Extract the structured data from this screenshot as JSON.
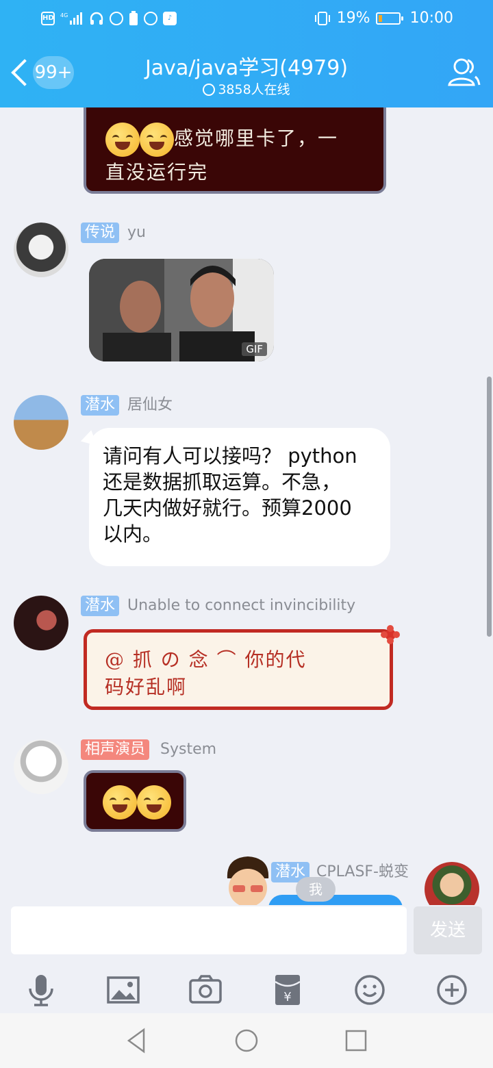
{
  "status_bar": {
    "icons_left": [
      "hd-icon",
      "4g-signal-icon",
      "headset-icon",
      "globe-icon",
      "battery-saver-icon",
      "video-icon",
      "tiktok-icon"
    ],
    "hd": "HD",
    "battery_pct": "19%",
    "time": "10:00",
    "battery_level": 0.19
  },
  "header": {
    "back_badge": "99+",
    "title": "Java/java学习(4979)",
    "online": "3858人在线"
  },
  "messages": {
    "m1": {
      "line1": "感觉哪里卡了，一",
      "line2": "直没运行完"
    },
    "m2": {
      "tag": "传说",
      "nick": "yu",
      "gif_label": "GIF"
    },
    "m3": {
      "tag": "潜水",
      "nick": "居仙女",
      "line1": "请问有人可以接吗？ python",
      "line2": "还是数据抓取运算。不急，",
      "line3": "几天内做好就行。预算2000",
      "line4": "以内。"
    },
    "m4": {
      "tag": "潜水",
      "nick": "Unable to connect invincibility",
      "line1": "@  抓  の  念  ⌒  你的代",
      "line2": "码好乱啊"
    },
    "m5": {
      "tag": "相声演员",
      "nick": "System"
    },
    "m6": {
      "tag": "潜水",
      "nick": "CPLASF-蜕变",
      "me": "我"
    }
  },
  "input": {
    "placeholder": "",
    "send": "发送"
  },
  "toolbar": [
    "mic-icon",
    "image-icon",
    "camera-icon",
    "red-packet-icon",
    "emoji-icon",
    "plus-icon"
  ],
  "colors": {
    "header": "#33a6f6",
    "blue_tag": "#8fc0f4",
    "red_tag": "#f4877d",
    "send_disabled": "#dfe1e6"
  }
}
